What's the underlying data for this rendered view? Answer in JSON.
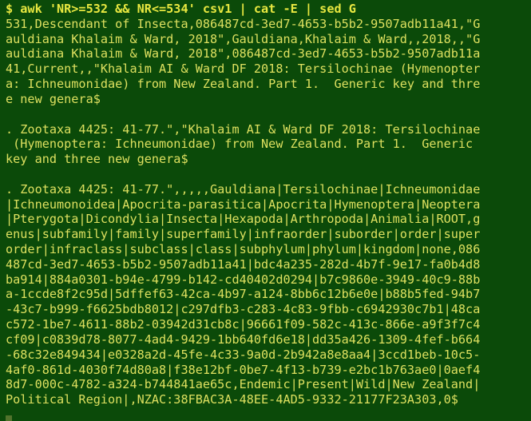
{
  "terminal": {
    "app_name": "terminal",
    "columns": 81,
    "rows": 28,
    "colors": {
      "background": "#0b4a09",
      "foreground": "#dde05f",
      "prompt_foreground": "#e8e840",
      "cursor": "#5f7a33"
    },
    "prompt_symbol": "$",
    "command": "awk 'NR>=532 && NR<=534' csv1 | cat -E | sed G",
    "prompt_line": "$ awk 'NR>=532 && NR<=534' csv1 | cat -E | sed G",
    "cursor": {
      "visible": true,
      "shape": "block",
      "column": 0,
      "row": 27
    },
    "lines": [
      "$ awk 'NR>=532 && NR<=534' csv1 | cat -E | sed G",
      "531,Descendant of Insecta,086487cd-3ed7-4653-b5b2-9507adb11a41,\"G",
      "auldiana Khalaim & Ward, 2018\",Gauldiana,Khalaim & Ward,,2018,,\"G",
      "auldiana Khalaim & Ward, 2018\",086487cd-3ed7-4653-b5b2-9507adb11a",
      "41,Current,,\"Khalaim AI & Ward DF 2018: Tersilochinae (Hymenopter",
      "a: Ichneumonidae) from New Zealand. Part 1.  Generic key and thre",
      "e new genera$",
      "",
      ". Zootaxa 4425: 41-77.\",\"Khalaim AI & Ward DF 2018: Tersilochinae",
      " (Hymenoptera: Ichneumonidae) from New Zealand. Part 1.  Generic ",
      "key and three new genera$",
      "",
      ". Zootaxa 4425: 41-77.\",,,,,Gauldiana|Tersilochinae|Ichneumonidae",
      "|Ichneumonoidea|Apocrita-parasitica|Apocrita|Hymenoptera|Neoptera",
      "|Pterygota|Dicondylia|Insecta|Hexapoda|Arthropoda|Animalia|ROOT,g",
      "enus|subfamily|family|superfamily|infraorder|suborder|order|super",
      "order|infraclass|subclass|class|subphylum|phylum|kingdom|none,086",
      "487cd-3ed7-4653-b5b2-9507adb11a41|bdc4a235-282d-4b7f-9e17-fa0b4d8",
      "ba914|884a0301-b94e-4799-b142-cd40402d0294|b7c9860e-3949-40c9-88b",
      "a-1ccde8f2c95d|5dffef63-42ca-4b97-a124-8bb6c12b6e0e|b88b5fed-94b7",
      "-43c7-b999-f6625bdb8012|c297dfb3-c283-4c83-9fbb-c6942930c7b1|48ca",
      "c572-1be7-4611-88b2-03942d31cb8c|96661f09-582c-413c-866e-a9f3f7c4",
      "cf09|c0839d78-8077-4ad4-9429-1bb640fd6e18|dd35a426-1309-4fef-b664",
      "-68c32e849434|e0328a2d-45fe-4c33-9a0d-2b942a8e8aa4|3ccd1beb-10c5-",
      "4af0-861d-4030f74d80a8|f38e12bf-0be7-4f13-b739-e2bc1b763ae0|0aef4",
      "8d7-000c-4782-a324-b744841ae65c,Endemic|Present|Wild|New Zealand|",
      "Political Region|,NZAC:38FBAC3A-48EE-4AD5-9332-21177F23A303,0$",
      ""
    ]
  }
}
